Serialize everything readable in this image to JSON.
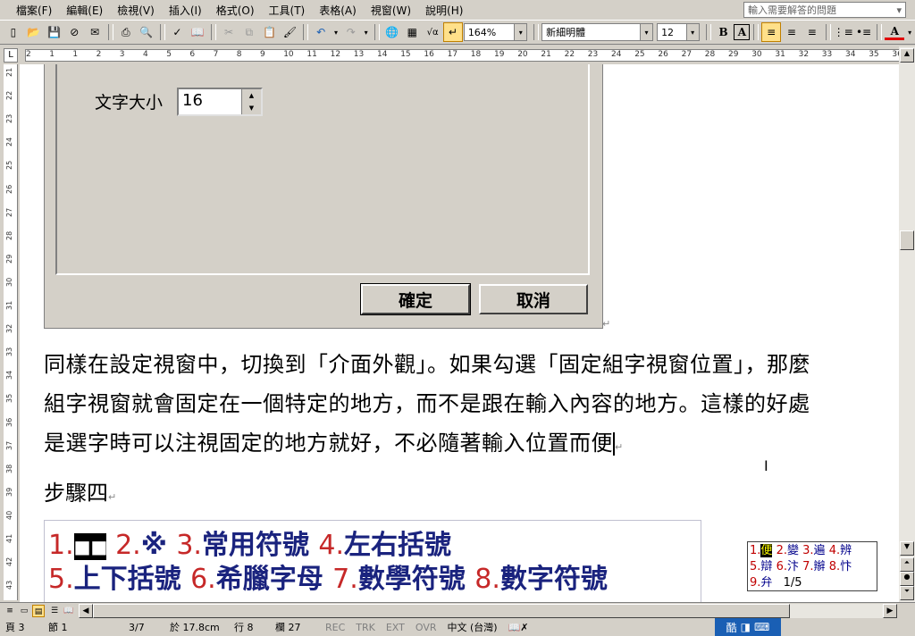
{
  "menubar": {
    "items": [
      "檔案(F)",
      "編輯(E)",
      "檢視(V)",
      "插入(I)",
      "格式(O)",
      "工具(T)",
      "表格(A)",
      "視窗(W)",
      "說明(H)"
    ],
    "help_placeholder": "輸入需要解答的問題"
  },
  "toolbar": {
    "zoom": "164%",
    "font": "新細明體",
    "size": "12",
    "bold_label": "B",
    "charborder_label": "A",
    "fontcolor_label": "A"
  },
  "ruler": {
    "ticks": [
      "2",
      "1",
      "1",
      "2",
      "3",
      "4",
      "5",
      "6",
      "7",
      "8",
      "9",
      "10",
      "11",
      "12",
      "13",
      "14",
      "15",
      "16",
      "17",
      "18",
      "19",
      "20",
      "21",
      "22",
      "23",
      "24",
      "25",
      "26",
      "27",
      "28",
      "29",
      "30",
      "31",
      "32",
      "33",
      "34",
      "35",
      "36"
    ]
  },
  "vruler": {
    "ticks": [
      "21",
      "22",
      "23",
      "24",
      "25",
      "26",
      "27",
      "28",
      "29",
      "30",
      "31",
      "32",
      "33",
      "34",
      "35",
      "36",
      "37",
      "38",
      "39",
      "40",
      "41",
      "42",
      "43"
    ]
  },
  "dialog": {
    "font_size_label": "文字大小",
    "font_size_value": "16",
    "ok_label": "確定",
    "cancel_label": "取消"
  },
  "document": {
    "para1_line1": "同樣在設定視窗中，切換到「介面外觀」。如果勾選「固定組字視窗位置」，那麼",
    "para1_line2": "組字視窗就會固定在一個特定的地方，而不是跟在輸入內容的地方。這樣的好處",
    "para1_line3": "是選字時可以注視固定的地方就好，不必隨著輸入位置而便",
    "step_title": "步驟四"
  },
  "symbols": {
    "line1": [
      {
        "n": "1.",
        "t": "■■"
      },
      {
        "n": "2.",
        "t": "※"
      },
      {
        "n": "3.",
        "t": "常用符號"
      },
      {
        "n": "4.",
        "t": "左右括號"
      }
    ],
    "line2": [
      {
        "n": "5.",
        "t": "上下括號"
      },
      {
        "n": "6.",
        "t": "希臘字母"
      },
      {
        "n": "7.",
        "t": "數學符號"
      },
      {
        "n": "8.",
        "t": "數字符號"
      }
    ]
  },
  "ime_candidates": {
    "row1": [
      {
        "n": "1.",
        "c": "便"
      },
      {
        "n": "2.",
        "c": "變"
      },
      {
        "n": "3.",
        "c": "遍"
      },
      {
        "n": "4.",
        "c": "辨"
      }
    ],
    "row2": [
      {
        "n": "5.",
        "c": "辯"
      },
      {
        "n": "6.",
        "c": "汴"
      },
      {
        "n": "7.",
        "c": "辮"
      },
      {
        "n": "8.",
        "c": "忭"
      }
    ],
    "row3": [
      {
        "n": "9.",
        "c": "弁"
      }
    ],
    "page": "1/5"
  },
  "statusbar": {
    "page": "頁 3",
    "section": "節 1",
    "pages": "3/7",
    "at": "於 17.8cm",
    "line": "行 8",
    "col": "欄 27",
    "rec": "REC",
    "trk": "TRK",
    "ext": "EXT",
    "ovr": "OVR",
    "lang": "中文 (台灣)",
    "ime_char": "酷"
  },
  "colors": {
    "chrome": "#d4d0c8",
    "symbol_text": "#1a237e",
    "symbol_num": "#c62828",
    "ime_bar": "#1a5fb4"
  }
}
